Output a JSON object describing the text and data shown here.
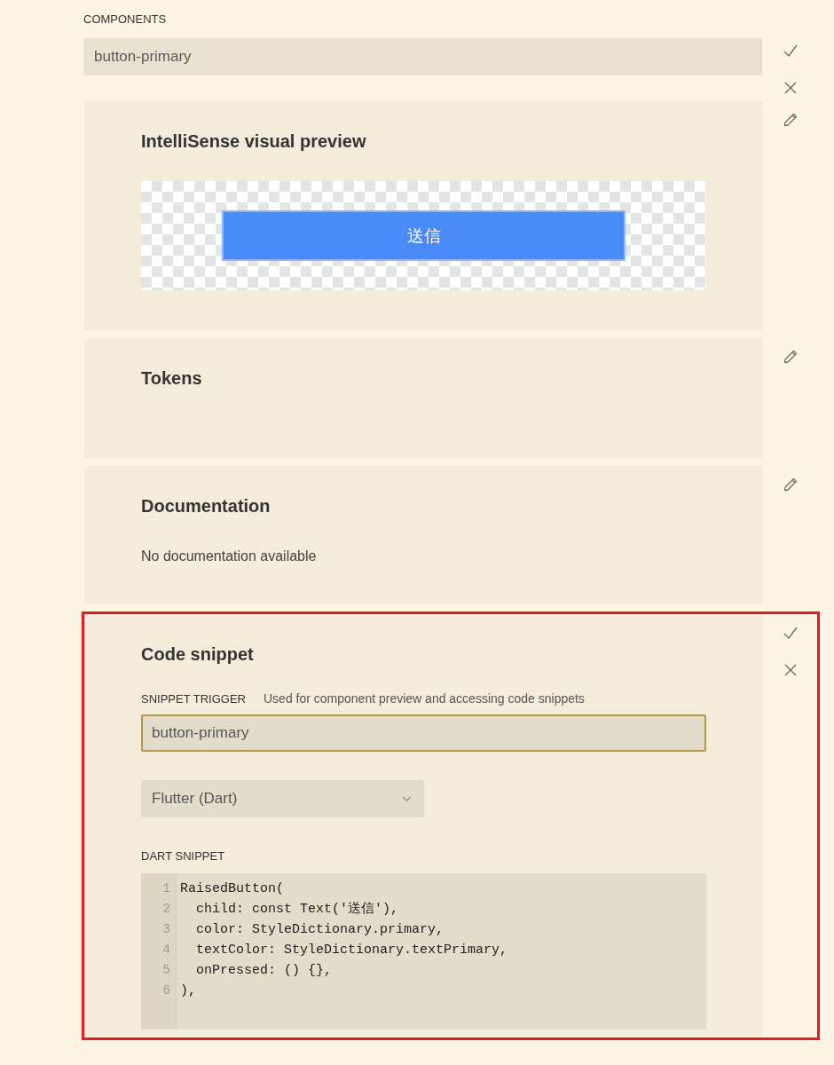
{
  "components": {
    "label": "COMPONENTS",
    "value": "button-primary",
    "editing": true
  },
  "sections": [
    {
      "kind": "preview",
      "title": "IntelliSense visual preview",
      "highlighted": false,
      "editing": false,
      "preview_button": "送信"
    },
    {
      "kind": "tokens",
      "title": "Tokens",
      "highlighted": false,
      "editing": false
    },
    {
      "kind": "docs",
      "title": "Documentation",
      "highlighted": false,
      "editing": false,
      "text": "No documentation available"
    },
    {
      "kind": "code",
      "title": "Code snippet",
      "highlighted": true,
      "editing": true,
      "trigger_label": "SNIPPET TRIGGER",
      "trigger_hint": "Used for component preview and accessing code snippets",
      "trigger_value": "button-primary",
      "language": "Flutter (Dart)",
      "snippet_label": "DART SNIPPET",
      "lines": [
        {
          "number": "1",
          "code": "RaisedButton("
        },
        {
          "number": "2",
          "code": "  child: const Text('送信'),"
        },
        {
          "number": "3",
          "code": "  color: StyleDictionary.primary,"
        },
        {
          "number": "4",
          "code": "  textColor: StyleDictionary.textPrimary,"
        },
        {
          "number": "5",
          "code": "  onPressed: () {},"
        },
        {
          "number": "6",
          "code": "),"
        }
      ]
    }
  ]
}
